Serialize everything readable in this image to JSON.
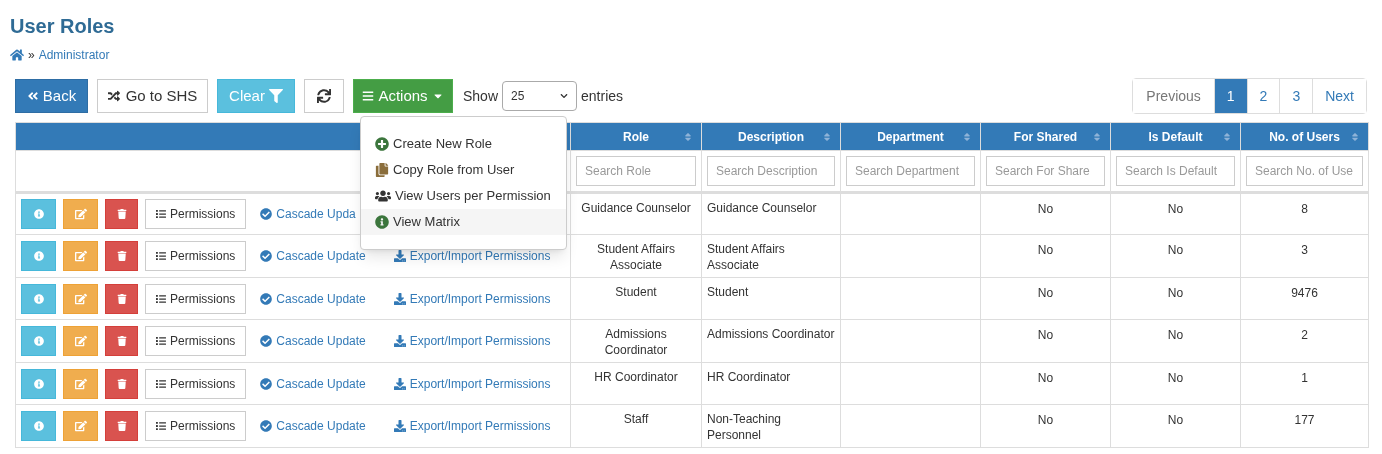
{
  "page_title": "User Roles",
  "breadcrumb": {
    "separator": "»",
    "items": [
      "Administrator"
    ]
  },
  "toolbar": {
    "buttons": [
      {
        "kind": "back",
        "label": "Back"
      },
      {
        "kind": "shs",
        "label": "Go to SHS"
      },
      {
        "kind": "clear",
        "label": "Clear"
      },
      {
        "kind": "refresh"
      },
      {
        "kind": "actions",
        "label": "Actions",
        "expanded": true
      }
    ],
    "show_label": "Show",
    "page_size": "25",
    "entries_label": "entries"
  },
  "actions_menu": [
    {
      "kind": "create",
      "label": "Create New Role",
      "highlighted": false
    },
    {
      "kind": "copy",
      "label": "Copy Role from User",
      "highlighted": false
    },
    {
      "kind": "users",
      "label": "View Users per Permission",
      "highlighted": false
    },
    {
      "kind": "matrix",
      "label": "View Matrix",
      "highlighted": true
    }
  ],
  "pagination": [
    {
      "label": "Previous",
      "selected": false
    },
    {
      "label": "1",
      "selected": true
    },
    {
      "label": "2",
      "selected": false
    },
    {
      "label": "3",
      "selected": false
    },
    {
      "label": "Next",
      "selected": false
    }
  ],
  "table": {
    "columns": [
      "Role",
      "Description",
      "Department",
      "For Shared",
      "Is Default",
      "No. of Users"
    ],
    "filters": [
      {
        "placeholder": "Search Role"
      },
      {
        "placeholder": "Search Description"
      },
      {
        "placeholder": "Search Department"
      },
      {
        "placeholder": "Search For Share"
      },
      {
        "placeholder": "Search Is Default"
      },
      {
        "placeholder": "Search No. of Use"
      }
    ],
    "rows": [
      {
        "permissions": "Permissions",
        "cascade": "Cascade Upda",
        "role": "Guidance Counselor",
        "description": "Guidance Counselor",
        "for_shared": "No",
        "is_default": "No",
        "users": "8"
      },
      {
        "permissions": "Permissions",
        "cascade": "Cascade Update",
        "export": "Export/Import Permissions",
        "role": "Student Affairs Associate",
        "description": "Student Affairs Associate",
        "for_shared": "No",
        "is_default": "No",
        "users": "3"
      },
      {
        "permissions": "Permissions",
        "cascade": "Cascade Update",
        "export": "Export/Import Permissions",
        "role": "Student",
        "description": "Student",
        "for_shared": "No",
        "is_default": "No",
        "users": "9476"
      },
      {
        "permissions": "Permissions",
        "cascade": "Cascade Update",
        "export": "Export/Import Permissions",
        "role": "Admissions Coordinator",
        "description": "Admissions Coordinator",
        "for_shared": "No",
        "is_default": "No",
        "users": "2"
      },
      {
        "permissions": "Permissions",
        "cascade": "Cascade Update",
        "export": "Export/Import Permissions",
        "role": "HR Coordinator",
        "description": "HR Coordinator",
        "for_shared": "No",
        "is_default": "No",
        "users": "1"
      },
      {
        "permissions": "Permissions",
        "cascade": "Cascade Update",
        "export": "Export/Import Permissions",
        "role": "Staff",
        "description": "Non-Teaching Personnel",
        "for_shared": "No",
        "is_default": "No",
        "users": "177"
      }
    ]
  }
}
